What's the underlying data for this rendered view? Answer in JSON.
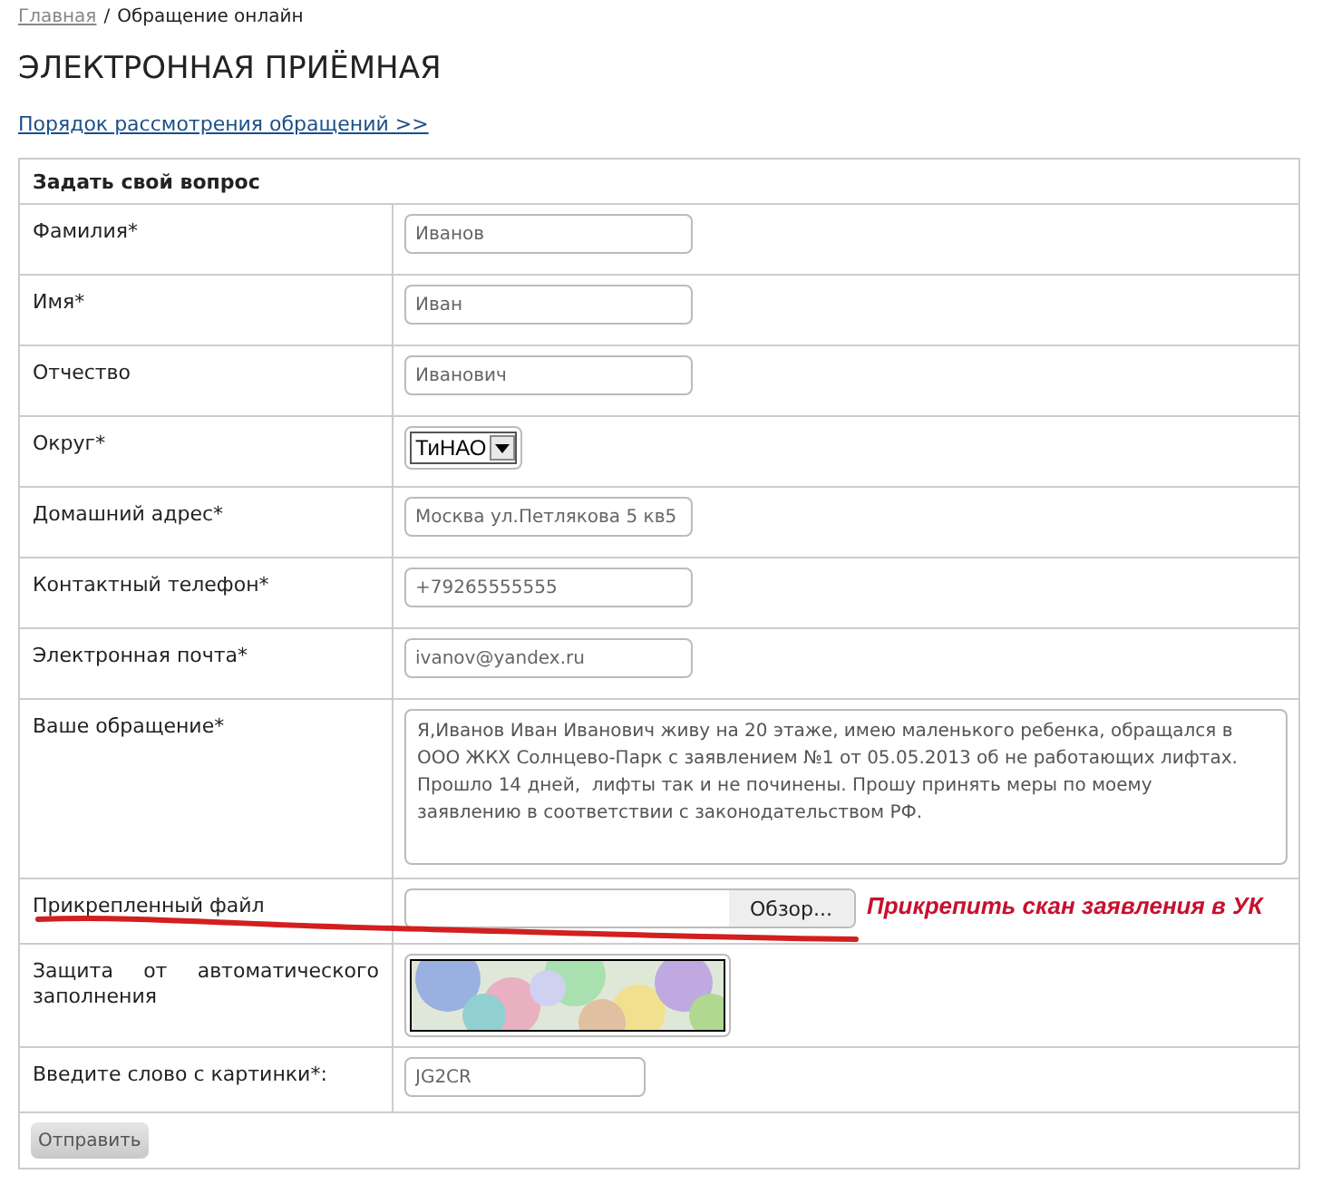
{
  "breadcrumbs": {
    "link": "Главная",
    "separator": "/",
    "current": "Обращение онлайн"
  },
  "title": "ЭЛЕКТРОННАЯ ПРИЁМНАЯ",
  "procedure_link": "Порядок рассмотрения обращений >>",
  "form": {
    "heading": "Задать свой вопрос",
    "rows": [
      {
        "kind": "text",
        "label": "Фамилия*",
        "value": "Иванов"
      },
      {
        "kind": "text",
        "label": "Имя*",
        "value": "Иван"
      },
      {
        "kind": "text",
        "label": "Отчество",
        "value": "Иванович"
      },
      {
        "kind": "select",
        "label": "Округ*",
        "value": "ТиНАО"
      },
      {
        "kind": "text",
        "label": "Домашний адрес*",
        "value": "Москва ул.Петлякова 5 кв5"
      },
      {
        "kind": "text",
        "label": "Контактный телефон*",
        "value": "+79265555555"
      },
      {
        "kind": "text",
        "label": "Электронная почта*",
        "value": "ivanov@yandex.ru"
      },
      {
        "kind": "textarea",
        "label": "Ваше обращение*",
        "value": "Я,Иванов Иван Иванович живу на 20 этаже, имею маленького ребенка, обращался в ООО ЖКХ Солнцево-Парк с заявлением №1 от 05.05.2013 об не работающих лифтах. Прошло 14 дней,  лифты так и не починены. Прошу принять меры по моему заявлению в соответствии с законодательством РФ."
      },
      {
        "kind": "file",
        "label": "Прикрепленный файл",
        "button": "Обзор...",
        "annotation": "Прикрепить скан заявления в УК"
      },
      {
        "kind": "captcha",
        "label": "Защита от автоматического заполнения"
      },
      {
        "kind": "captcha_input",
        "label": "Введите слово с картинки*:",
        "value": "JG2CR"
      }
    ],
    "submit": "Отправить"
  }
}
